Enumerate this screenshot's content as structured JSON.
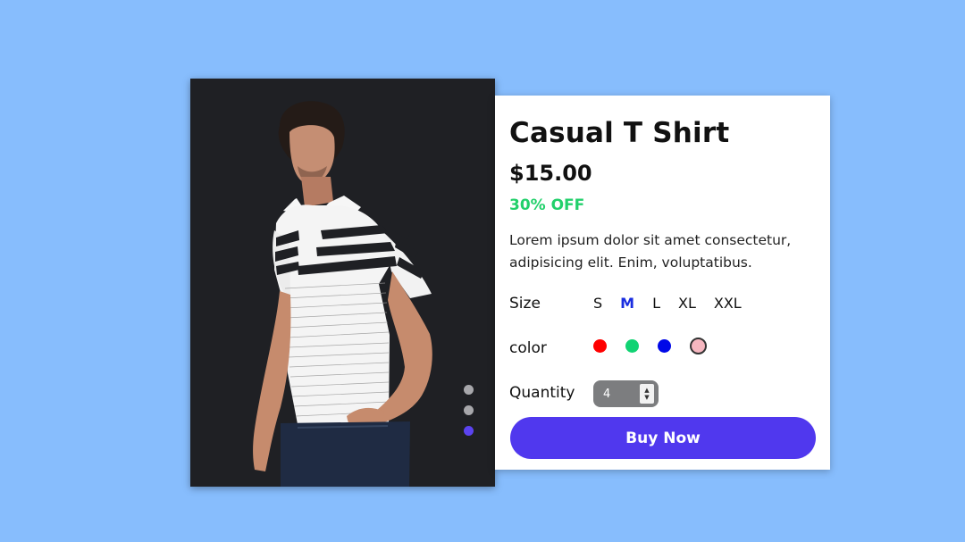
{
  "product": {
    "title": "Casual T Shirt",
    "price": "$15.00",
    "discount": "30% OFF",
    "description": "Lorem ipsum dolor sit amet consectetur, adipisicing elit. Enim, voluptatibus."
  },
  "gallery": {
    "image_icon": "model-wearing-striped-polo-shirt",
    "dots": [
      {
        "color": "#a7a7ab",
        "active": false
      },
      {
        "color": "#a7a7ab",
        "active": false
      },
      {
        "color": "#5b43f0",
        "active": true
      }
    ]
  },
  "size": {
    "label": "Size",
    "options": [
      "S",
      "M",
      "L",
      "XL",
      "XXL"
    ],
    "selected": "M"
  },
  "color": {
    "label": "color",
    "options": [
      {
        "name": "red",
        "hex": "#ff0000"
      },
      {
        "name": "green",
        "hex": "#11d373"
      },
      {
        "name": "blue",
        "hex": "#0008e8"
      },
      {
        "name": "pink",
        "hex": "#f6b7c0",
        "selected": true
      }
    ]
  },
  "quantity": {
    "label": "Quantity",
    "value": "4"
  },
  "buy": {
    "label": "Buy Now"
  },
  "colors": {
    "page_background": "#87bdfd",
    "image_background": "#1f2024",
    "accent": "#5038ee",
    "discount": "#22d06b"
  }
}
